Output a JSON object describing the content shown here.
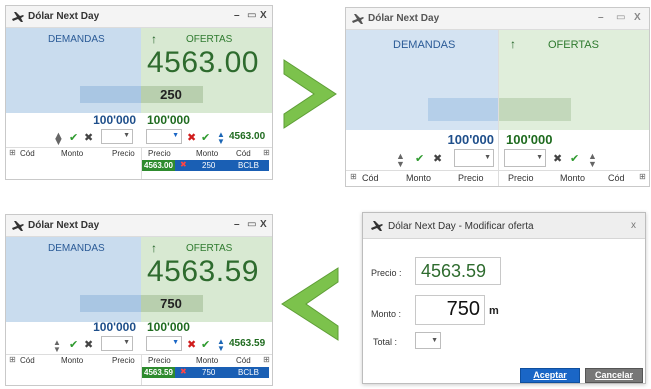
{
  "colors": {
    "bid_panel": "#c9dcee",
    "offer_panel": "#d8e9d2",
    "price_green": "#2e6b2e",
    "accept_blue": "#1a66c6",
    "chevron_green": "#7cc24c"
  },
  "window": {
    "title": "Dólar Next Day",
    "min_icon": "–",
    "max_icon": "▭",
    "close_icon": "X"
  },
  "labels": {
    "demandas": "DEMANDAS",
    "ofertas": "OFERTAS",
    "arrow": "↑"
  },
  "columns": {
    "cod": "Cód",
    "monto": "Monto",
    "precio": "Precio"
  },
  "panels": {
    "top_left": {
      "price": "4563.00",
      "qty": "250",
      "vol_bid": "100'000",
      "vol_offer": "100'000",
      "ctrl_price": "4563.00",
      "order": {
        "price": "4563.00",
        "monto": "250",
        "cod": "BCLB"
      }
    },
    "top_right": {
      "vol_bid": "100'000",
      "vol_offer": "100'000"
    },
    "bottom_left": {
      "price": "4563.59",
      "qty": "750",
      "vol_bid": "100'000",
      "vol_offer": "100'000",
      "ctrl_price": "4563.59",
      "order": {
        "price": "4563.59",
        "monto": "750",
        "cod": "BCLB"
      }
    }
  },
  "dialog": {
    "title": "Dólar Next Day - Modificar oferta",
    "close_icon": "x",
    "precio_label": "Precio :",
    "precio_value": "4563.59",
    "monto_label": "Monto :",
    "monto_value": "750",
    "monto_unit": "m",
    "total_label": "Total :",
    "accept": "Aceptar",
    "cancel": "Cancelar"
  }
}
